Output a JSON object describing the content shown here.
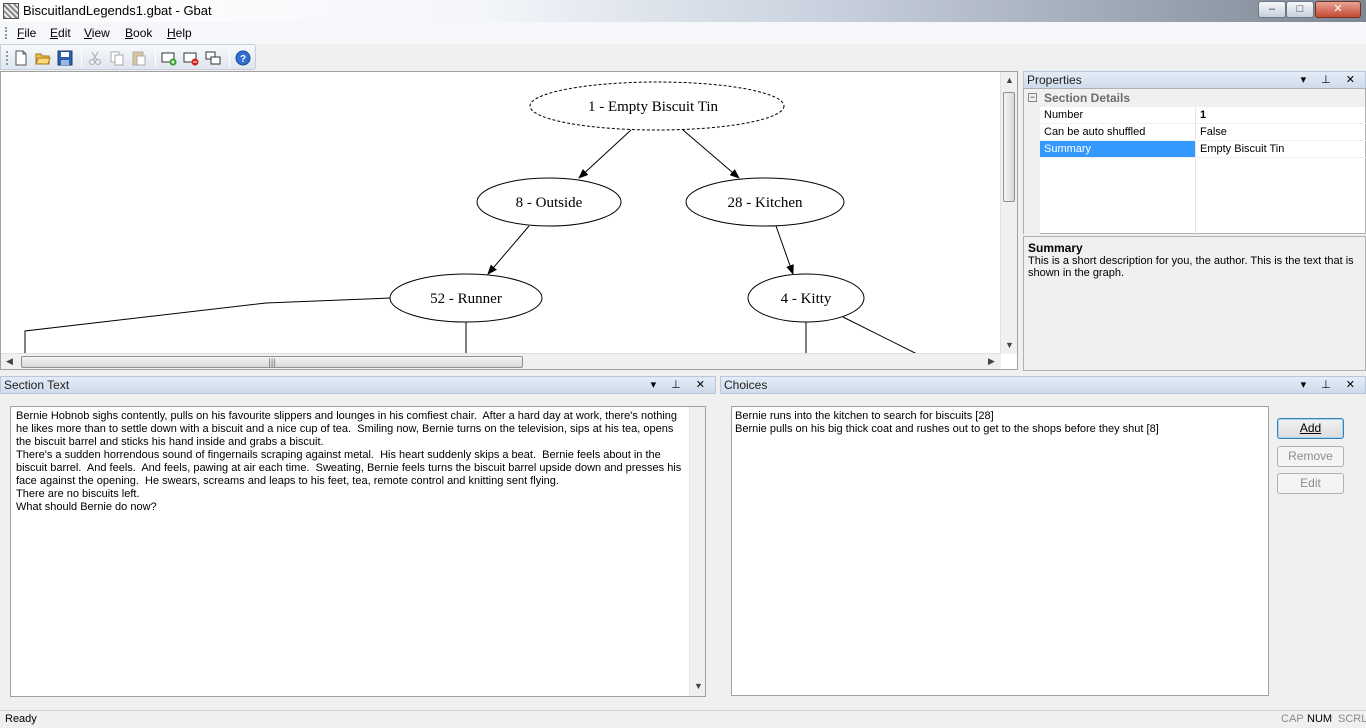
{
  "window": {
    "title": "BiscuitlandLegends1.gbat - Gbat",
    "controls": {
      "minimize": "–",
      "maximize": "□",
      "close": "✕"
    }
  },
  "menu": [
    {
      "label": "File",
      "mnemonic": "F",
      "rest": "ile"
    },
    {
      "label": "Edit",
      "mnemonic": "E",
      "rest": "dit"
    },
    {
      "label": "View",
      "mnemonic": "V",
      "rest": "iew"
    },
    {
      "label": "Book",
      "mnemonic": "B",
      "rest": "ook"
    },
    {
      "label": "Help",
      "mnemonic": "H",
      "rest": "elp"
    }
  ],
  "toolbar": {
    "icons": [
      "new-file-icon",
      "open-folder-icon",
      "save-icon",
      "cut-icon",
      "copy-icon",
      "paste-icon",
      "add-section-icon",
      "delete-section-icon",
      "link-sections-icon",
      "help-icon"
    ]
  },
  "graph": {
    "nodes": [
      {
        "label": "1 - Empty Biscuit Tin",
        "dashed": true
      },
      {
        "label": "8 - Outside"
      },
      {
        "label": "28 - Kitchen"
      },
      {
        "label": "52 - Runner"
      },
      {
        "label": "4 - Kitty"
      }
    ],
    "hscroll_grip": "|||"
  },
  "properties": {
    "header": "Properties",
    "category": "Section Details",
    "category_toggle": "−",
    "rows": [
      {
        "name": "Number",
        "value": "1",
        "bold": true
      },
      {
        "name": "Can be auto shuffled",
        "value": "False"
      },
      {
        "name": "Summary",
        "value": "Empty Biscuit Tin",
        "selected": true
      }
    ],
    "description_title": "Summary",
    "description_text": "This is a short description for you, the author. This is the text that is shown in the graph."
  },
  "section_text": {
    "header": "Section Text",
    "lines": [
      "Bernie Hobnob sighs contently, pulls on his favourite slippers and lounges in his comfiest chair.  After a hard day at work, there's nothing he likes more than to settle down with a biscuit and a nice cup of tea.  Smiling now, Bernie turns on the television, sips at his tea, opens the biscuit barrel and sticks his hand inside and grabs a biscuit.",
      "There's a sudden horrendous sound of fingernails scraping against metal.  His heart suddenly skips a beat.  Bernie feels about in the biscuit barrel.  And feels.  And feels, pawing at air each time.  Sweating, Bernie feels turns the biscuit barrel upside down and presses his face against the opening.  He swears, screams and leaps to his feet, tea, remote control and knitting sent flying.",
      "There are no biscuits left.",
      "What should Bernie do now?"
    ]
  },
  "choices": {
    "header": "Choices",
    "items": [
      "Bernie runs into the kitchen to search for biscuits [28]",
      "Bernie pulls on his big thick coat and rushes out to get to the shops before they shut [8]"
    ],
    "buttons": {
      "add": "Add",
      "remove": "Remove",
      "edit": "Edit"
    }
  },
  "panel_buttons": "▾ ⊥ ✕",
  "status": {
    "text": "Ready",
    "indicators": [
      {
        "label": "CAP",
        "on": false
      },
      {
        "label": "NUM",
        "on": true
      },
      {
        "label": "SCRL",
        "on": false
      }
    ]
  }
}
